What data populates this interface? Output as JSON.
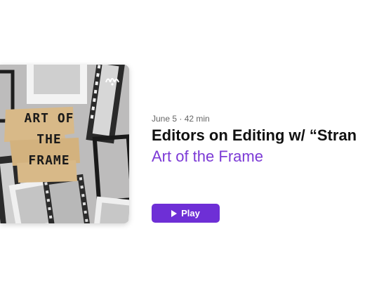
{
  "episode": {
    "meta": "June 5 · 42 min",
    "title": "Editors on Editing w/ “Stran",
    "show": "Art of the Frame"
  },
  "artwork": {
    "wordmark": [
      "ART OF",
      "THE",
      "FRAME"
    ],
    "badge_icon": "anchor-podcast-icon"
  },
  "actions": {
    "play_label": "Play",
    "play_icon": "play-icon"
  },
  "colors": {
    "accent": "#6e2fd6",
    "show_name": "#7c3ad6",
    "artwork_bg": "#bdbcbc",
    "tape": "#d8b988"
  }
}
